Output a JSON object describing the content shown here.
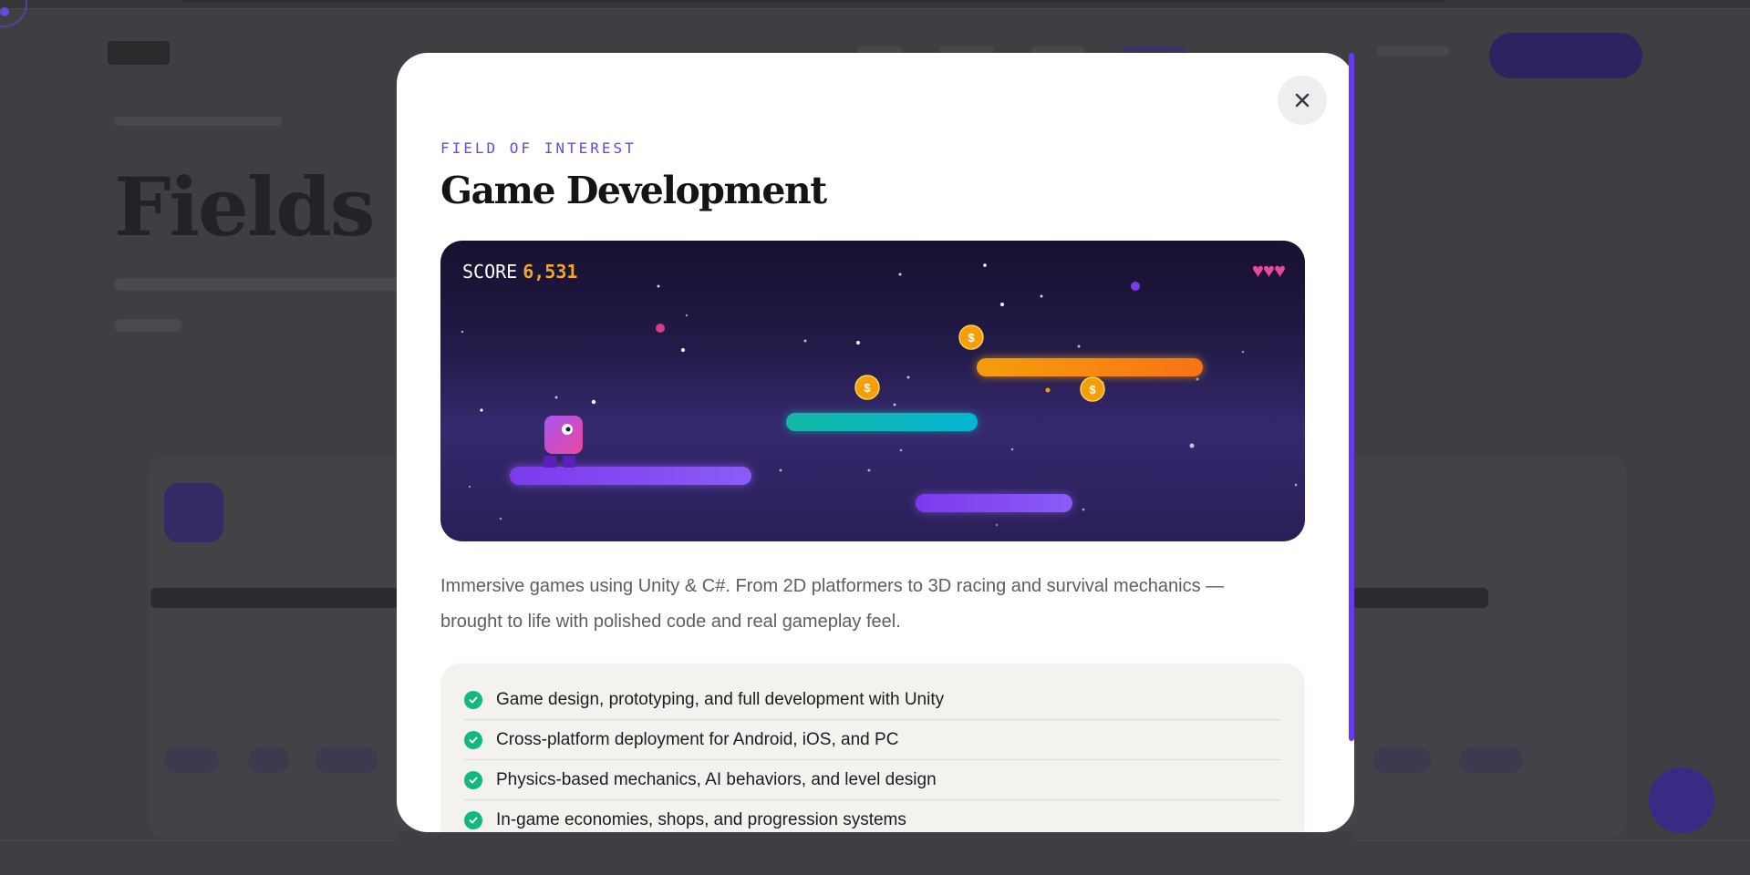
{
  "modal": {
    "eyebrow": "FIELD OF INTEREST",
    "title": "Game Development",
    "description": "Immersive games using Unity & C#. From 2D platformers to 3D racing and survival mechanics — brought to life with polished code and real gameplay feel.",
    "close_icon": "close-icon",
    "scene": {
      "score_label": "SCORE",
      "score_value": "6,531",
      "lives": "♥♥♥",
      "coin_symbol": "$"
    },
    "features": [
      "Game design, prototyping, and full development with Unity",
      "Cross-platform deployment for Android, iOS, and PC",
      "Physics-based mechanics, AI behaviors, and level design",
      "In-game economies, shops, and progression systems"
    ]
  },
  "background_page": {
    "title": "Fields o"
  },
  "colors": {
    "accent": "#6d45e8",
    "score": "#f5a623",
    "hearts": "#ec4899",
    "check": "#10b981"
  }
}
